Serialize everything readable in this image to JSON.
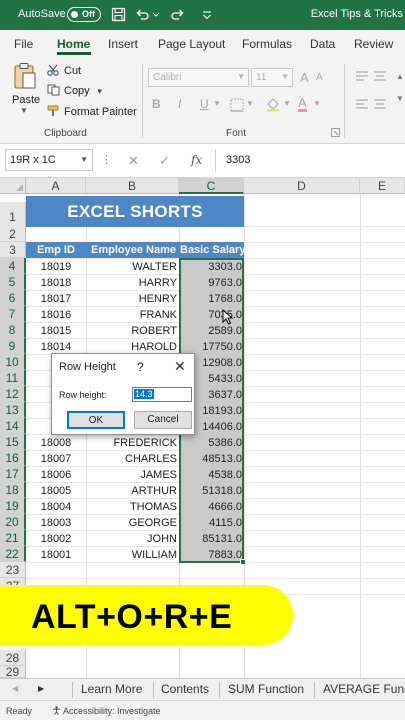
{
  "title_bar": {
    "autosave_label": "AutoSave",
    "autosave_state": "Off",
    "document_title": "Excel Tips & Tricks"
  },
  "ribbon_tabs": [
    "File",
    "Home",
    "Insert",
    "Page Layout",
    "Formulas",
    "Data",
    "Review"
  ],
  "active_tab": "Home",
  "clipboard": {
    "paste": "Paste",
    "cut": "Cut",
    "copy": "Copy",
    "format_painter": "Format Painter",
    "group_label": "Clipboard"
  },
  "font_group": {
    "font_name": "Calibri",
    "font_size": "11",
    "group_label": "Font",
    "bold": "B",
    "italic": "I",
    "underline": "U",
    "grow": "A",
    "shrink": "A"
  },
  "formula_bar": {
    "name_box": "19R x 1C",
    "fx": "fx",
    "value": "3303"
  },
  "columns": [
    "A",
    "B",
    "C",
    "D",
    "E"
  ],
  "row_numbers": [
    "1",
    "2",
    "3",
    "4",
    "5",
    "6",
    "7",
    "8",
    "9",
    "10",
    "11",
    "12",
    "13",
    "14",
    "15",
    "16",
    "17",
    "18",
    "19",
    "20",
    "21",
    "22",
    "23",
    "27",
    "28",
    "29"
  ],
  "sheet": {
    "banner": "EXCEL SHORTS",
    "headers": [
      "Emp ID",
      "Employee Name",
      "Basic Salary"
    ],
    "rows": [
      {
        "id": "18019",
        "name": "WALTER",
        "salary": "3303.0"
      },
      {
        "id": "18018",
        "name": "HARRY",
        "salary": "9763.0"
      },
      {
        "id": "18017",
        "name": "HENRY",
        "salary": "1768.0"
      },
      {
        "id": "18016",
        "name": "FRANK",
        "salary": "7035.0"
      },
      {
        "id": "18015",
        "name": "ROBERT",
        "salary": "2589.0"
      },
      {
        "id": "18014",
        "name": "HAROLD",
        "salary": "17750.0"
      },
      {
        "id": "",
        "name": "",
        "salary": "12908.0"
      },
      {
        "id": "",
        "name": "",
        "salary": "5433.0"
      },
      {
        "id": "",
        "name": "",
        "salary": "3637.0"
      },
      {
        "id": "",
        "name": "",
        "salary": "18193.0"
      },
      {
        "id": "",
        "name": "",
        "salary": "14406.0"
      },
      {
        "id": "18008",
        "name": "FREDERICK",
        "salary": "5386.0"
      },
      {
        "id": "18007",
        "name": "CHARLES",
        "salary": "48513.0"
      },
      {
        "id": "18006",
        "name": "JAMES",
        "salary": "4538.0"
      },
      {
        "id": "18005",
        "name": "ARTHUR",
        "salary": "51318.0"
      },
      {
        "id": "18004",
        "name": "THOMAS",
        "salary": "4666.0"
      },
      {
        "id": "18003",
        "name": "GEORGE",
        "salary": "4115.0"
      },
      {
        "id": "18002",
        "name": "JOHN",
        "salary": "85131.0"
      },
      {
        "id": "18001",
        "name": "WILLIAM",
        "salary": "7883.0"
      }
    ]
  },
  "dialog": {
    "title": "Row Height",
    "help": "?",
    "close": "✕",
    "label": "Row height:",
    "value": "14.3",
    "ok": "OK",
    "cancel": "Cancel"
  },
  "overlay_text": "ALT+O+R+E",
  "sheet_tabs": [
    "Learn More",
    "Contents",
    "SUM Function",
    "AVERAGE Func"
  ],
  "status": {
    "ready": "Ready",
    "accessibility": "Accessibility: Investigate"
  },
  "colors": {
    "excel_green": "#217346",
    "header_blue": "#4f86c6",
    "selection_gray": "#c9c9c9",
    "overlay_yellow": "#ffff00"
  }
}
